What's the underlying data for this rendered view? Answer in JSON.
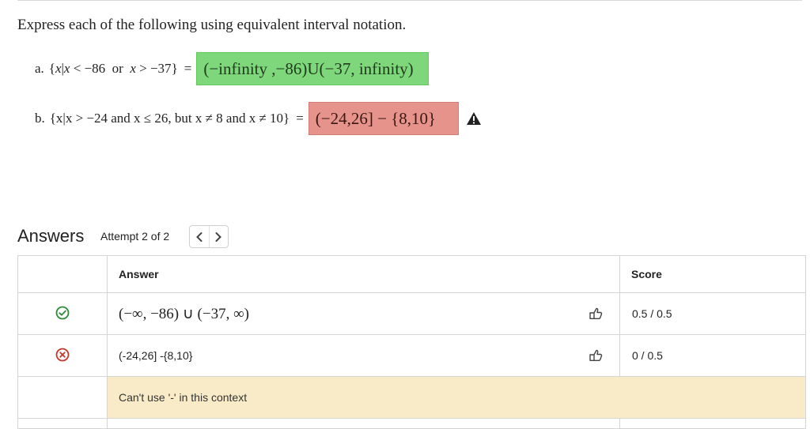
{
  "prompt": "Express each of the following using equivalent interval notation.",
  "problems": [
    {
      "label": "a.",
      "set_open": "{",
      "var": "x",
      "bar": "|",
      "var2": "x",
      "cond1_op": "<",
      "cond1_val": "−86",
      "joiner": "or",
      "var3": "x",
      "cond2_op": ">",
      "cond2_val": "−37",
      "set_close": "}",
      "equals": "=",
      "answer": "(−infinity ,−86)U(−37, infinity)",
      "status": "correct"
    },
    {
      "label": "b.",
      "text": "{x|x > −24 and x ≤ 26, but x ≠ 8 and x ≠ 10}",
      "equals": "=",
      "answer": "(−24,26] − {8,10}",
      "status": "incorrect"
    }
  ],
  "answers_section": {
    "title": "Answers",
    "attempt": "Attempt 2 of 2",
    "prev": "<",
    "next": ">",
    "headers": {
      "answer": "Answer",
      "score": "Score"
    },
    "rows": [
      {
        "status": "correct",
        "answer": "(−∞, −86) ∪ (−37, ∞)",
        "score": "0.5 / 0.5"
      },
      {
        "status": "incorrect",
        "answer": "(-24,26] -{8,10}",
        "score": "0 / 0.5"
      }
    ],
    "feedback": "Can't use '-' in this context"
  },
  "colors": {
    "correct_bg": "#7ed77a",
    "incorrect_bg": "#e6948b",
    "feedback_bg": "#faebc8",
    "correct_icon": "#2e8b3a",
    "incorrect_icon": "#c0392b"
  },
  "icons": {
    "correct": "check-circle-icon",
    "incorrect": "x-circle-icon",
    "warning": "warning-triangle-icon",
    "feedback": "feedback-hand-icon"
  }
}
